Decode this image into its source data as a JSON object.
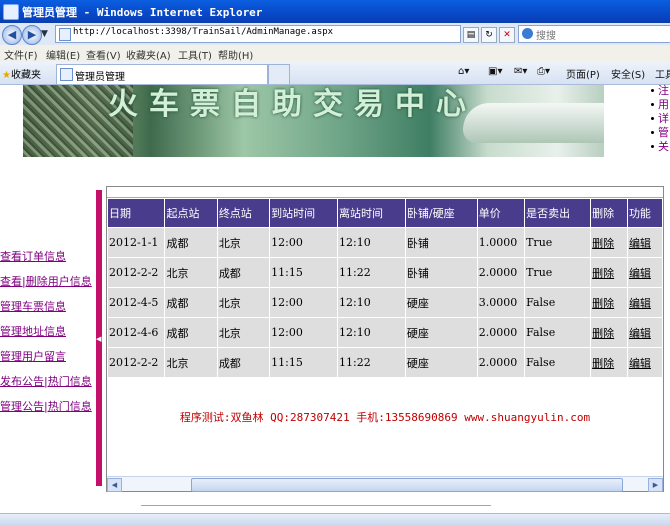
{
  "window": {
    "title": "管理员管理 - Windows Internet Explorer"
  },
  "address": {
    "url": "http://localhost:3398/TrainSail/AdminManage.aspx",
    "search_placeholder": "搜搜"
  },
  "menu": [
    "文件(F)",
    "编辑(E)",
    "查看(V)",
    "收藏夹(A)",
    "工具(T)",
    "帮助(H)"
  ],
  "favorites_label": "收藏夹",
  "tab_title": "管理员管理",
  "command_bar": {
    "page": "页面(P)",
    "safety": "安全(S)",
    "tools": "工具"
  },
  "banner_title": "火车票自助交易中心",
  "right_links": [
    "注",
    "用",
    "详",
    "管",
    "关"
  ],
  "left_nav": [
    "查看订单信息",
    "查看|删除用户信息",
    "管理车票信息",
    "管理地址信息",
    "管理用户留言",
    "发布公告|热门信息",
    "管理公告|热门信息"
  ],
  "grid": {
    "headers": [
      "日期",
      "起点站",
      "终点站",
      "到站时间",
      "离站时间",
      "卧铺/硬座",
      "单价",
      "是否卖出",
      "删除",
      "功能"
    ],
    "rows": [
      [
        "2012-1-1",
        "成都",
        "北京",
        "12:00",
        "12:10",
        "卧铺",
        "1.0000",
        "True",
        "删除",
        "编辑"
      ],
      [
        "2012-2-2",
        "北京",
        "成都",
        "11:15",
        "11:22",
        "卧铺",
        "2.0000",
        "True",
        "删除",
        "编辑"
      ],
      [
        "2012-4-5",
        "成都",
        "北京",
        "12:00",
        "12:10",
        "硬座",
        "3.0000",
        "False",
        "删除",
        "编辑"
      ],
      [
        "2012-4-6",
        "成都",
        "北京",
        "12:00",
        "12:10",
        "硬座",
        "2.0000",
        "False",
        "删除",
        "编辑"
      ],
      [
        "2012-2-2",
        "北京",
        "成都",
        "11:15",
        "11:22",
        "硬座",
        "2.0000",
        "False",
        "删除",
        "编辑"
      ]
    ]
  },
  "footer_text": "程序测试:双鱼林 QQ:287307421 手机:13558690869 www.shuangyulin.com",
  "colors": {
    "header_bg": "#4a3c8c",
    "cell_bg": "#dedede",
    "accent_bar": "#c4106a",
    "footer_text": "#c00000"
  }
}
